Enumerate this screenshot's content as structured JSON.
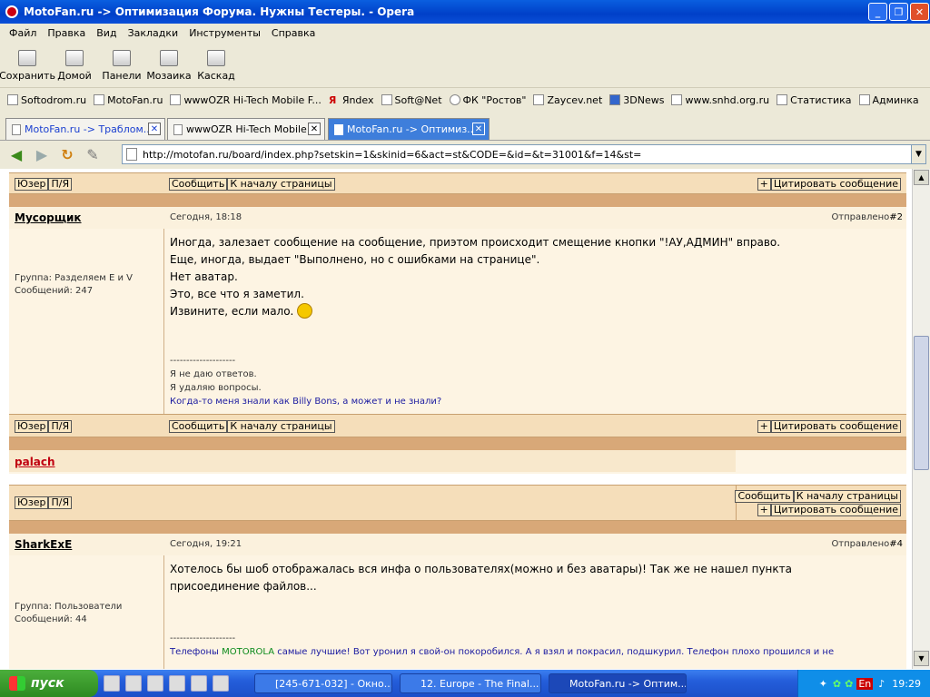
{
  "window": {
    "title": "MotoFan.ru -> Оптимизация Форума. Нужны Тестеры. - Opera"
  },
  "menu": [
    "Файл",
    "Правка",
    "Вид",
    "Закладки",
    "Инструменты",
    "Справка"
  ],
  "toolbar": [
    "Сохранить",
    "Домой",
    "Панели",
    "Мозаика",
    "Каскад"
  ],
  "bookmarks": [
    "Softodrom.ru",
    "MotoFan.ru",
    "wwwOZR Hi-Tech Mobile F...",
    "Яndex",
    "Soft@Net",
    "ФК \"Ростов\"",
    "Zaycev.net",
    "3DNews",
    "www.snhd.org.ru",
    "Статистика",
    "Админка"
  ],
  "tabs": [
    "MotoFan.ru -> Траблом...",
    "wwwOZR Hi-Tech Mobile ...",
    "MotoFan.ru -> Оптимиз..."
  ],
  "address": {
    "url": "http://motofan.ru/board/index.php?setskin=1&skinid=6&act=st&CODE=&id=&t=31001&f=14&st="
  },
  "forum": {
    "btn_user": "Юзер",
    "btn_pm": "П/Я",
    "btn_report": "Сообщить",
    "btn_top": "К началу страницы",
    "btn_quote": "+",
    "btn_quote_label": "Цитировать сообщение",
    "sent_label": "Отправлено",
    "posts": [
      {
        "author": "Мусорщик",
        "date": "Сегодня, 18:18",
        "num": "#2",
        "group": "Группа: Разделяем Е и V",
        "count": "Сообщений: 247",
        "lines": [
          "Иногда, залезает сообщение на сообщение, приэтом происходит смещение кнопки \"!АУ,АДМИН\" вправо.",
          "Еще, иногда, выдает \"Выполнено, но с ошибками на странице\".",
          "Нет аватар.",
          "Это, все что я заметил.",
          "Извините, если мало."
        ],
        "sig_dash": "--------------------",
        "sig": [
          "Я не даю ответов.",
          "Я удаляю вопросы.",
          "Когда-то меня знали как Billy Bons, а может и не знали?"
        ]
      },
      {
        "author": "palach"
      },
      {
        "author": "SharkExE",
        "date": "Сегодня, 19:21",
        "num": "#4",
        "group": "Группа: Пользователи",
        "count": "Сообщений: 44",
        "lines": [
          "Хотелось бы шоб отображалась вся инфа о пользователях(можно и без аватары)! Так же не нашел пункта",
          "присоединение файлов..."
        ],
        "sig_dash": "--------------------",
        "sig_pre": "Телефоны ",
        "sig_brand": "MOTOROLA",
        "sig_post": " самые лучшие! Вот уронил я свой-он покоробился. А я взял и покрасил, подшкурил. Телефон плохо прошился и не"
      }
    ]
  },
  "taskbar": {
    "start": "пуск",
    "tasks": [
      "[245-671-032] - Окно...",
      "12. Europe - The Final...",
      "MotoFan.ru -> Оптим..."
    ],
    "lang": "En",
    "time": "19:29"
  },
  "colors": {
    "accent": "#245edb",
    "post_bg": "#fdf4e3",
    "bar": "#f5deba",
    "sep": "#d8a878"
  }
}
